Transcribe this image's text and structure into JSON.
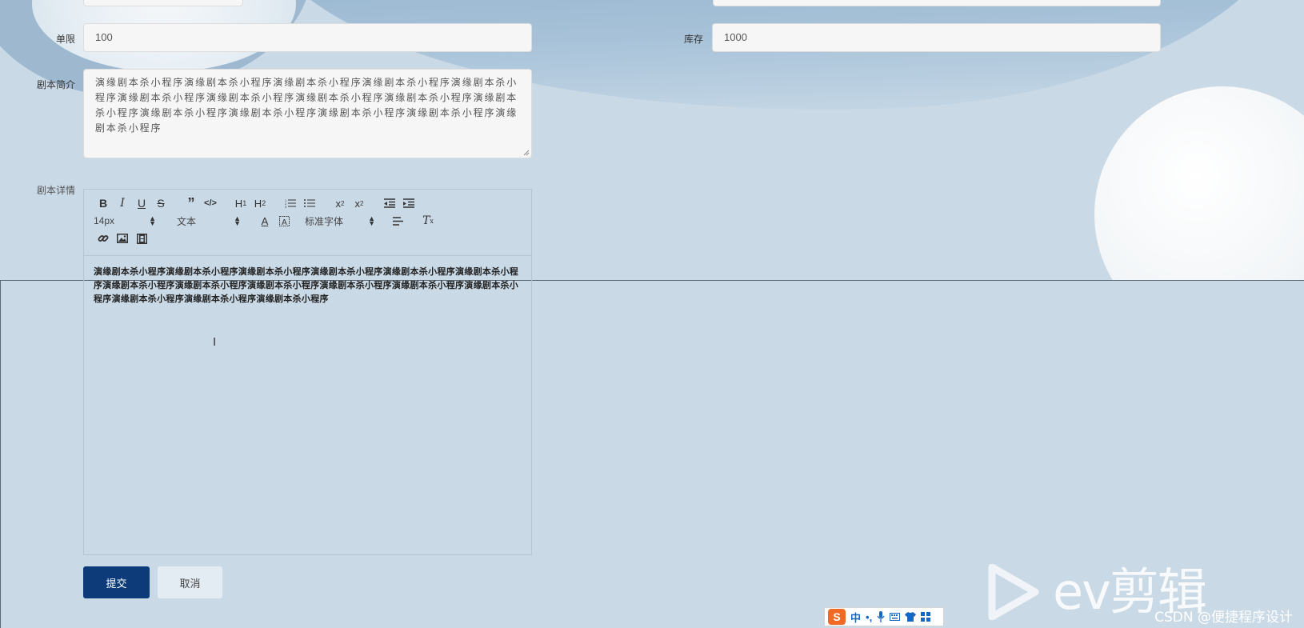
{
  "form": {
    "quota_label": "单限",
    "quota_value": "100",
    "stock_label": "库存",
    "stock_value": "1000",
    "summary_label": "剧本简介",
    "summary_text": "演缘剧本杀小程序演缘剧本杀小程序演缘剧本杀小程序演缘剧本杀小程序演缘剧本杀小程序演缘剧本杀小程序演缘剧本杀小程序演缘剧本杀小程序演缘剧本杀小程序演缘剧本杀小程序演缘剧本杀小程序演缘剧本杀小程序演缘剧本杀小程序演缘剧本杀小程序演缘剧本杀小程序",
    "detail_label": "剧本详情"
  },
  "editor": {
    "font_size_select": "14px",
    "header_select": "文本",
    "font_family_select": "标准字体",
    "content": "演缘剧本杀小程序演缘剧本杀小程序演缘剧本杀小程序演缘剧本杀小程序演缘剧本杀小程序演缘剧本杀小程序演缘剧本杀小程序演缘剧本杀小程序演缘剧本杀小程序演缘剧本杀小程序演缘剧本杀小程序演缘剧本杀小程序演缘剧本杀小程序演缘剧本杀小程序演缘剧本杀小程序",
    "toolbar_icons": [
      "bold-icon",
      "italic-icon",
      "underline-icon",
      "strike-icon",
      "blockquote-icon",
      "code-block-icon",
      "h1-icon",
      "h2-icon",
      "ordered-list-icon",
      "bullet-list-icon",
      "subscript-icon",
      "superscript-icon",
      "outdent-icon",
      "indent-icon",
      "font-color-icon",
      "background-color-icon",
      "align-icon",
      "clean-format-icon",
      "link-icon",
      "image-icon",
      "video-icon"
    ]
  },
  "actions": {
    "submit_label": "提交",
    "cancel_label": "取消"
  },
  "ime": {
    "logo": "S",
    "mode": "中",
    "punct": "•,"
  },
  "watermark": {
    "text": "ev剪辑"
  },
  "credit": "CSDN @便捷程序设计",
  "colors": {
    "primary": "#0d3b7a",
    "background": "#cad9e6",
    "input_bg": "#f6f6f6"
  }
}
